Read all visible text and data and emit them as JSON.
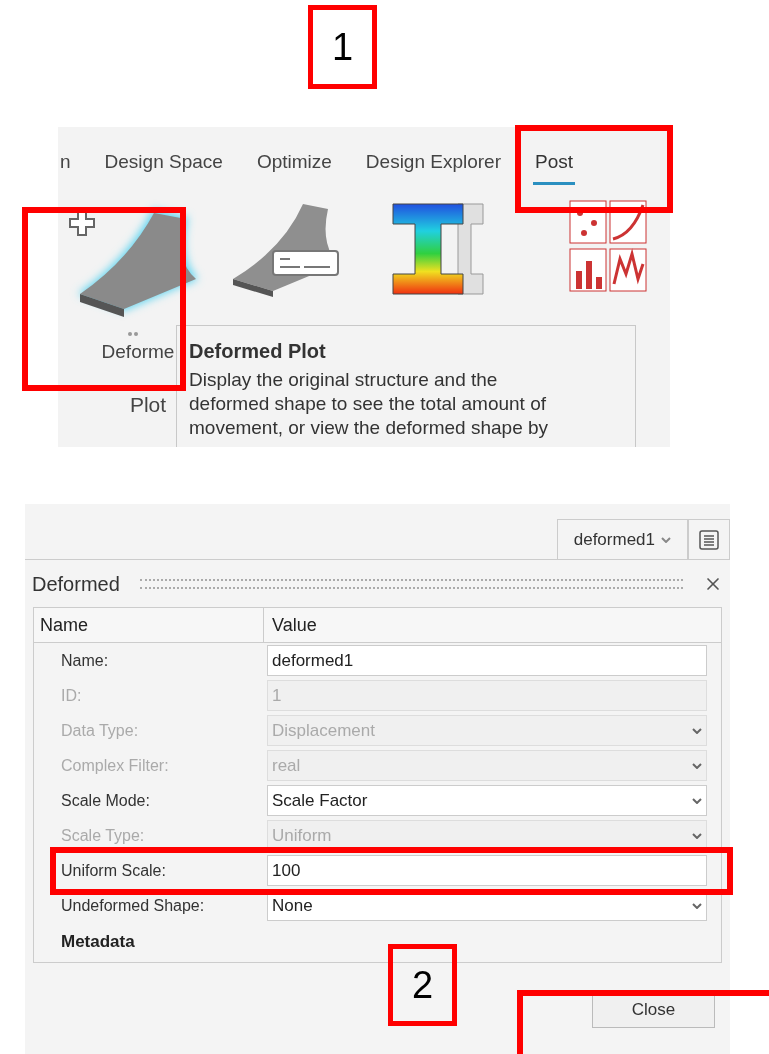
{
  "callouts": [
    {
      "label": "1"
    },
    {
      "label": "2"
    }
  ],
  "ribbon": {
    "tabs": [
      {
        "label": "n",
        "selected": false
      },
      {
        "label": "Design Space",
        "selected": false
      },
      {
        "label": "Optimize",
        "selected": false
      },
      {
        "label": "Design Explorer",
        "selected": false
      },
      {
        "label": "Post",
        "selected": true
      }
    ],
    "tools": [
      {
        "kind": "deformed",
        "label": "Deforme",
        "sublabel": "Plot"
      },
      {
        "kind": "deformed-note"
      },
      {
        "kind": "contour"
      },
      {
        "kind": "charts"
      }
    ],
    "tooltip": {
      "title": "Deformed Plot",
      "text": "Display the original structure and the\ndeformed shape to see the total amount of\nmovement, or view the deformed shape by"
    }
  },
  "panel": {
    "selector": "deformed1",
    "dialog_title": "Deformed",
    "columns": [
      "Name",
      "Value"
    ],
    "rows": [
      {
        "label": "Name:",
        "value": "deformed1",
        "kind": "text",
        "disabled": false
      },
      {
        "label": "ID:",
        "value": "1",
        "kind": "text",
        "disabled": true
      },
      {
        "label": "Data Type:",
        "value": "Displacement",
        "kind": "select",
        "disabled": true
      },
      {
        "label": "Complex Filter:",
        "value": "real",
        "kind": "select",
        "disabled": true
      },
      {
        "label": "Scale Mode:",
        "value": "Scale Factor",
        "kind": "select",
        "disabled": false
      },
      {
        "label": "Scale Type:",
        "value": "Uniform",
        "kind": "select",
        "disabled": true
      },
      {
        "label": "Uniform Scale:",
        "value": "100",
        "kind": "text",
        "disabled": false
      },
      {
        "label": "Undeformed Shape:",
        "value": "None",
        "kind": "select",
        "disabled": false
      }
    ],
    "section": "Metadata",
    "button": "Close"
  }
}
